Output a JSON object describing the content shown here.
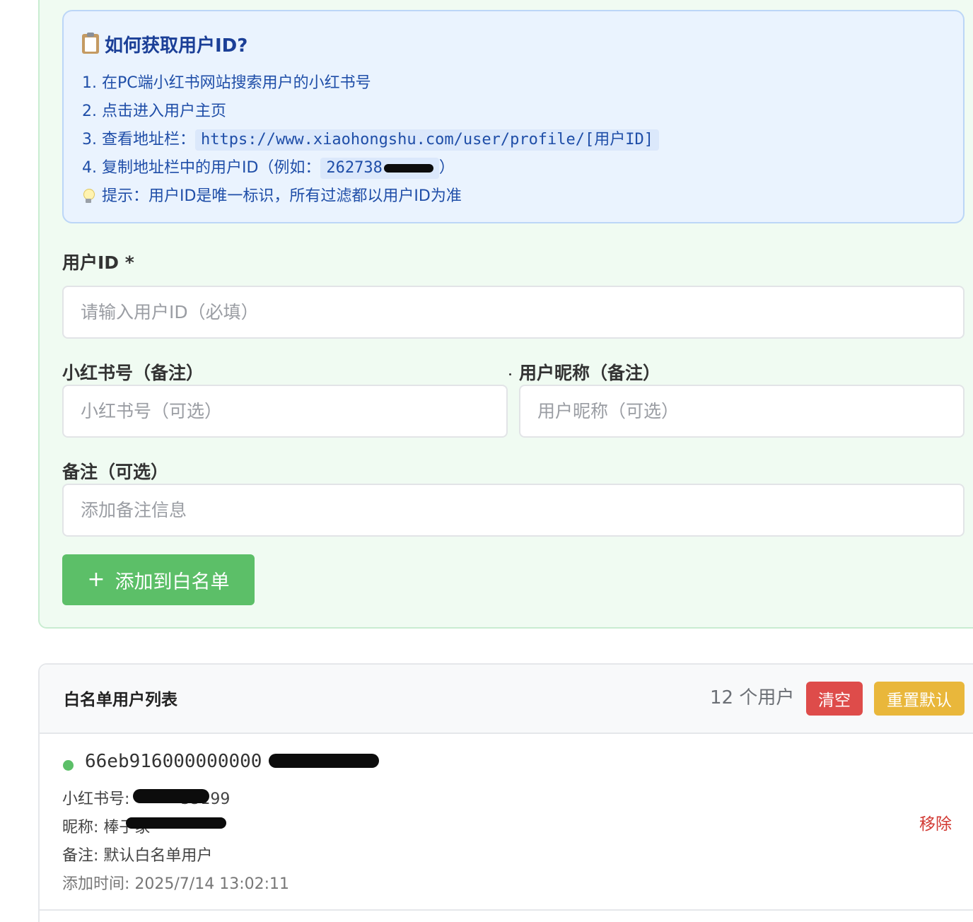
{
  "info": {
    "title": "如何获取用户ID?",
    "steps": [
      "1. 在PC端小红书网站搜索用户的小红书号",
      "2. 点击进入用户主页",
      "3. 查看地址栏：",
      "4. 复制地址栏中的用户ID（例如："
    ],
    "url_example": "https://www.xiaohongshu.com/user/profile/[用户ID]",
    "id_example": "262738",
    "id_example_close": "）",
    "tip": "提示：用户ID是唯一标识，所有过滤都以用户ID为准"
  },
  "form": {
    "user_id_label": "用户ID *",
    "user_id_placeholder": "请输入用户ID（必填）",
    "xhs_label": "小红书号（备注）",
    "xhs_placeholder": "小红书号（可选）",
    "nickname_label": "用户昵称（备注）",
    "nickname_placeholder": "用户昵称（可选）",
    "note_label": "备注（可选）",
    "note_placeholder": "添加备注信息",
    "add_button": "添加到白名单",
    "add_icon": "+"
  },
  "whitelist": {
    "title": "白名单用户列表",
    "count": "12 个用户",
    "clear_button": "清空",
    "reset_button": "重置默认",
    "users": [
      {
        "id": "66eb916000000000",
        "xhs": "小红书号:",
        "xhs_tail": "35199",
        "nickname": "昵称: 棒子家",
        "note": "备注: 默认白名单用户",
        "added": "添加时间: 2025/7/14 13:02:11",
        "remove": "移除"
      }
    ]
  },
  "colors": {
    "accent_green": "#5cbf68",
    "danger": "#de4c4a",
    "warning": "#e9b73b",
    "info_text": "#1f4ea8"
  },
  "icons": [
    "clipboard-icon",
    "bulb-icon",
    "plus-icon",
    "status-dot"
  ]
}
